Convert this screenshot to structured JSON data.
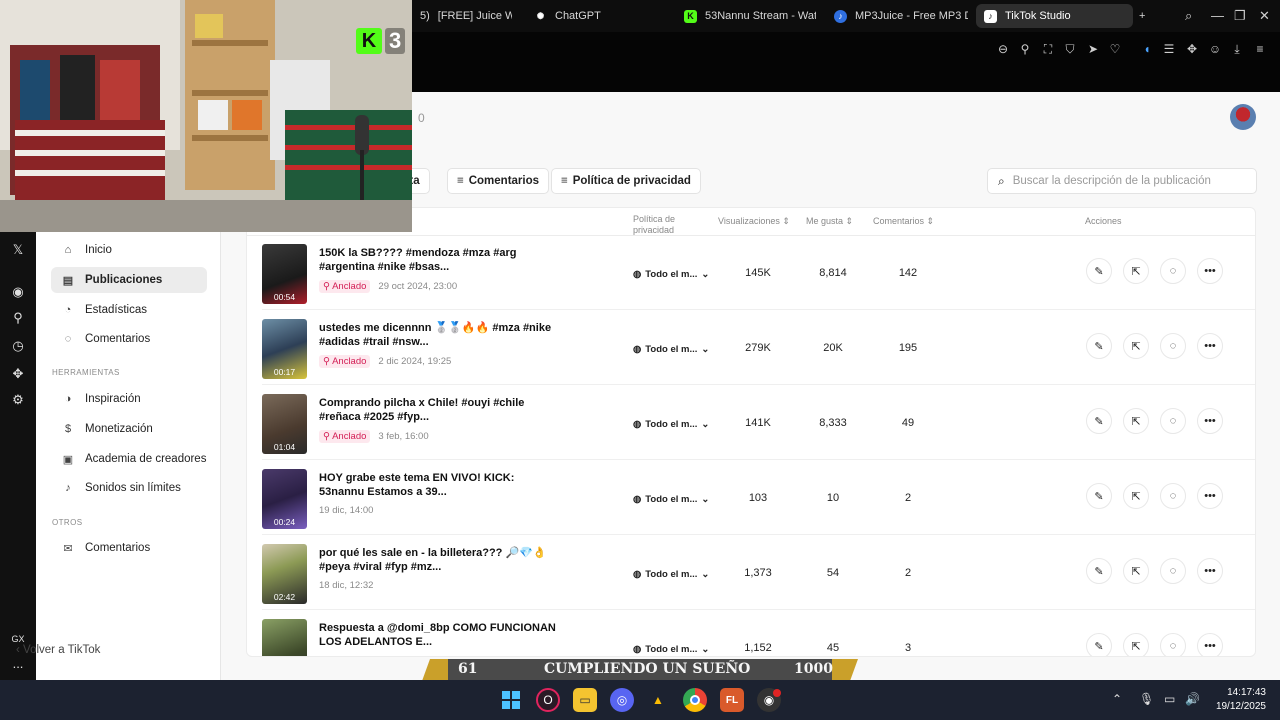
{
  "browser": {
    "tabs": [
      {
        "label": "[FREE] Juice WRLD",
        "favicon": "red-square",
        "leading_text": "5)"
      },
      {
        "label": "ChatGPT",
        "favicon": "chatgpt-icon"
      },
      {
        "label": "53Nannu Stream - Wat",
        "favicon": "kick-icon"
      },
      {
        "label": "MP3Juice - Free MP3 D",
        "favicon": "mp3juice-icon"
      },
      {
        "label": "TikTok Studio",
        "favicon": "tiktok-icon",
        "active": true
      }
    ],
    "new_tab": "+"
  },
  "webcam": {
    "kick_badge": "3"
  },
  "header": {
    "count": "0"
  },
  "filters": {
    "first_label": "usta",
    "comments_label": "Comentarios",
    "privacy_label": "Política de privacidad",
    "search_placeholder": "Buscar la descripción de la publicación"
  },
  "table": {
    "columns": {
      "privacy": "Política de privacidad",
      "views": "Visualizaciones",
      "likes": "Me gusta",
      "comments": "Comentarios",
      "actions": "Acciones"
    },
    "rows": [
      {
        "caption": "150K la SB???? #mendoza #mza #arg #argentina #nike #bsas...",
        "duration": "00:54",
        "pinned": true,
        "date": "29 oct 2024, 23:00",
        "privacy": "Todo el m...",
        "views": "145K",
        "likes": "8,814",
        "comments": "142"
      },
      {
        "caption": "ustedes me dicennnn 🥈🥈🔥🔥 #mza #nike #adidas #trail #nsw...",
        "duration": "00:17",
        "pinned": true,
        "date": "2 dic 2024, 19:25",
        "privacy": "Todo el m...",
        "views": "279K",
        "likes": "20K",
        "comments": "195"
      },
      {
        "caption": "Comprando pilcha x Chile! #ouyi #chile #reñaca #2025 #fyp...",
        "duration": "01:04",
        "pinned": true,
        "date": "3 feb, 16:00",
        "privacy": "Todo el m...",
        "views": "141K",
        "likes": "8,333",
        "comments": "49"
      },
      {
        "caption": "HOY grabe este tema EN VIVO! KICK: 53nannu Estamos a 39...",
        "duration": "00:24",
        "pinned": false,
        "date": "19 dic, 14:00",
        "privacy": "Todo el m...",
        "views": "103",
        "likes": "10",
        "comments": "2"
      },
      {
        "caption": "por qué les sale en - la billetera??? 🔎💎👌 #peya #viral #fyp #mz...",
        "duration": "02:42",
        "pinned": false,
        "date": "18 dic, 12:32",
        "privacy": "Todo el m...",
        "views": "1,373",
        "likes": "54",
        "comments": "2"
      },
      {
        "caption": "Respuesta a @domi_8bp COMO FUNCIONAN LOS ADELANTOS E...",
        "duration": "",
        "pinned": false,
        "date": "",
        "privacy": "Todo el m...",
        "views": "1,152",
        "likes": "45",
        "comments": "3"
      }
    ],
    "pinned_label": "Anclado"
  },
  "sidebar": {
    "items": [
      {
        "label": "Inicio",
        "icon": "home-icon"
      },
      {
        "label": "Publicaciones",
        "icon": "posts-icon",
        "active": true
      },
      {
        "label": "Estadísticas",
        "icon": "stats-icon"
      },
      {
        "label": "Comentarios",
        "icon": "comment-icon"
      }
    ],
    "section_tools": "HERRAMIENTAS",
    "tools": [
      {
        "label": "Inspiración",
        "icon": "bulb-icon"
      },
      {
        "label": "Monetización",
        "icon": "dollar-icon"
      },
      {
        "label": "Academia de creadores",
        "icon": "academy-icon"
      },
      {
        "label": "Sonidos sin límites",
        "icon": "music-icon"
      }
    ],
    "section_other": "OTROS",
    "other": [
      {
        "label": "Comentarios",
        "icon": "mail-icon"
      }
    ],
    "back": "Volver a TikTok"
  },
  "banner": {
    "left": "61",
    "center": "CUMPLIENDO UN SUEÑO",
    "right": "1000"
  },
  "leftbar": {
    "gx": "GX",
    "more": "..."
  },
  "taskbar": {
    "time": "14:17:43",
    "date": "19/12/2025"
  },
  "colors": {
    "pin_red": "#d31e55",
    "kick_green": "#53fc18",
    "taskbar": "#1c2230"
  }
}
